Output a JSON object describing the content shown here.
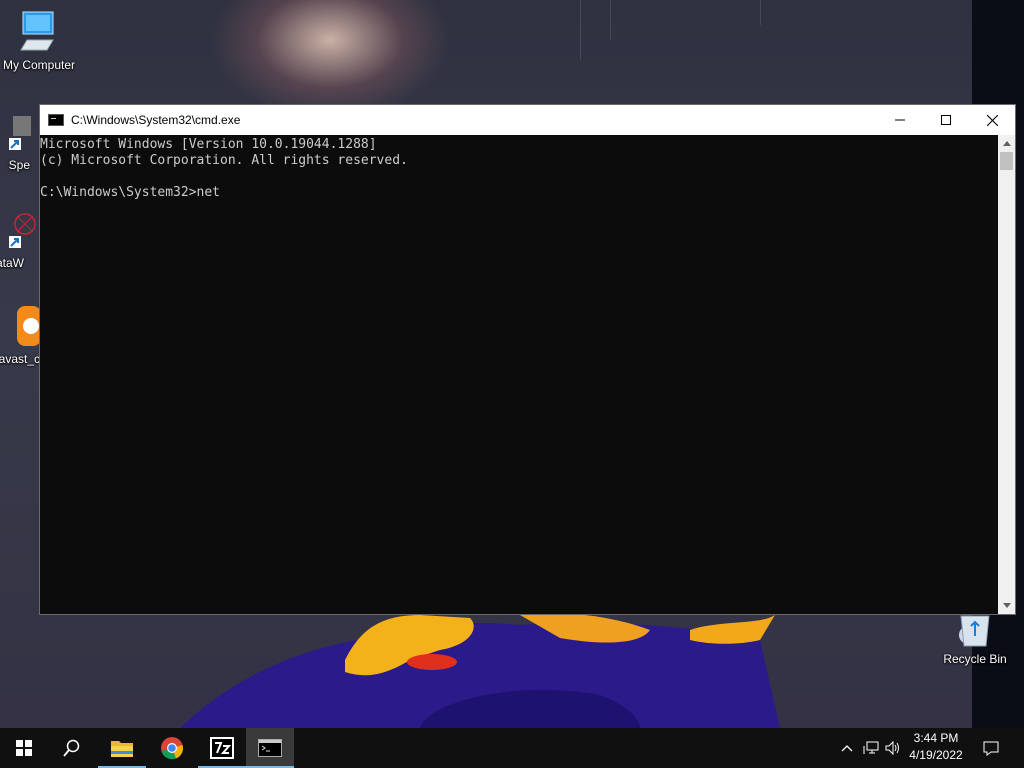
{
  "desktop": {
    "icons": [
      {
        "label": "My Computer"
      },
      {
        "label": "Spe"
      },
      {
        "label": "DataW"
      },
      {
        "label": "avast_c"
      },
      {
        "label": "Recycle Bin"
      }
    ]
  },
  "window": {
    "title": "C:\\Windows\\System32\\cmd.exe",
    "lines": [
      "Microsoft Windows [Version 10.0.19044.1288]",
      "(c) Microsoft Corporation. All rights reserved.",
      "",
      "C:\\Windows\\System32>net"
    ],
    "controls": [
      "minimize-icon",
      "maximize-icon",
      "close-icon"
    ]
  },
  "taskbar": {
    "items": [
      "windows-start-icon",
      "search-icon",
      "file-explorer-icon",
      "chrome-icon",
      "7zip-icon",
      "cmd-icon"
    ],
    "clock": {
      "time": "3:44 PM",
      "date": "4/19/2022"
    },
    "tray": [
      "chevron-up-icon",
      "network-icon",
      "volume-icon",
      "notifications-icon"
    ]
  },
  "colors": {
    "console_bg": "#0c0c0c",
    "console_fg": "#cccccc",
    "taskbar_bg": "#101010",
    "accent": "#76b9ed"
  }
}
